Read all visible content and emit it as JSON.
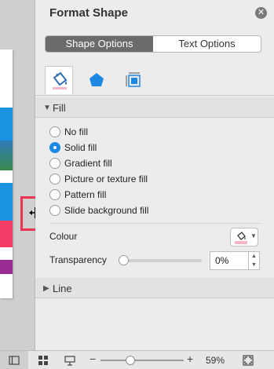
{
  "panel": {
    "title": "Format Shape",
    "close_icon": "close-icon",
    "segments": [
      {
        "label": "Shape Options",
        "active": true
      },
      {
        "label": "Text Options",
        "active": false
      }
    ],
    "tabs": [
      {
        "icon": "paint-bucket-icon",
        "selected": true
      },
      {
        "icon": "pentagon-icon",
        "selected": false
      },
      {
        "icon": "size-properties-icon",
        "selected": false
      }
    ]
  },
  "fill": {
    "header": "Fill",
    "options": [
      {
        "label": "No fill",
        "selected": false
      },
      {
        "label": "Solid fill",
        "selected": true
      },
      {
        "label": "Gradient fill",
        "selected": false
      },
      {
        "label": "Picture or texture fill",
        "selected": false
      },
      {
        "label": "Pattern fill",
        "selected": false
      },
      {
        "label": "Slide background fill",
        "selected": false
      }
    ],
    "colour_label": "Colour",
    "transparency_label": "Transparency",
    "transparency_value": "0%",
    "transparency_fraction": 0
  },
  "line": {
    "header": "Line"
  },
  "statusbar": {
    "zoom_label": "59%",
    "zoom_fraction": 0.36
  },
  "colors": {
    "accent": "#1e88e5",
    "highlight": "#e8344f"
  }
}
